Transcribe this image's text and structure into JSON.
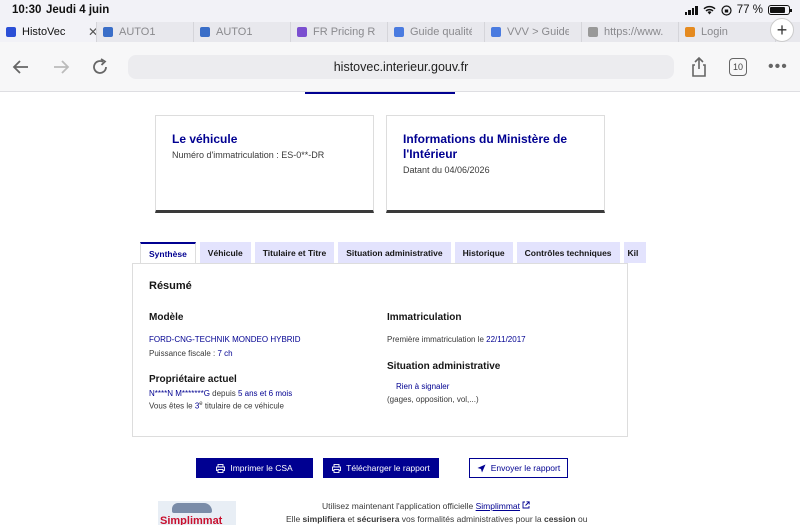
{
  "status": {
    "time": "10:30",
    "date": "Jeudi 4 juin",
    "battery": "77 %"
  },
  "browser_tabs": [
    {
      "label": "HistoVec",
      "active": true,
      "favicon_color": "#2b4fd6"
    },
    {
      "label": "AUTO1",
      "active": false,
      "favicon_color": "#3a6ec8"
    },
    {
      "label": "AUTO1",
      "active": false,
      "favicon_color": "#3a6ec8"
    },
    {
      "label": "FR Pricing Re",
      "active": false,
      "favicon_color": "#7b4fd0"
    },
    {
      "label": "Guide qualité",
      "active": false,
      "favicon_color": "#4a7be0"
    },
    {
      "label": "VVV > Guide",
      "active": false,
      "favicon_color": "#4a7be0"
    },
    {
      "label": "https://www.",
      "active": false,
      "favicon_color": "#999999"
    },
    {
      "label": "Login",
      "active": false,
      "favicon_color": "#e58a1f"
    }
  ],
  "url": "histovec.interieur.gouv.fr",
  "tab_count": "10",
  "cards": {
    "vehicle": {
      "title": "Le véhicule",
      "plate": "Numéro d'immatriculation : ES-0**-DR"
    },
    "ministry": {
      "title": "Informations du Ministère de l'Intérieur",
      "date": "Datant du 04/06/2026"
    }
  },
  "page_tabs": [
    "Synthèse",
    "Véhicule",
    "Titulaire et Titre",
    "Situation administrative",
    "Historique",
    "Contrôles techniques",
    "Kil"
  ],
  "resume": {
    "heading": "Résumé",
    "modele": {
      "label": "Modèle",
      "value": "FORD-CNG-TECHNIK MONDEO HYBRID",
      "puissance_label": "Puissance fiscale : ",
      "puissance_value": "7 ch"
    },
    "proprietaire": {
      "label": "Propriétaire actuel",
      "name": "N****N M*******G",
      "depuis": " depuis ",
      "duree": "5 ans et 6 mois",
      "titulaire_prefix": "Vous êtes le ",
      "titulaire_rank": "3",
      "titulaire_sup": "e",
      "titulaire_suffix": " titulaire de ce véhicule"
    },
    "immatriculation": {
      "label": "Immatriculation",
      "first_label": "Première immatriculation le ",
      "first_date": "22/11/2017"
    },
    "situation": {
      "label": "Situation administrative",
      "value": "Rien à signaler",
      "detail": "(gages, opposition, vol,...)"
    }
  },
  "actions": {
    "print": "Imprimer le CSA",
    "download": "Télécharger le rapport",
    "send": "Envoyer le rapport"
  },
  "simplimmat": {
    "line1_prefix": "Utilisez maintenant l'application officielle ",
    "line1_link": "Simplimmat",
    "line2_prefix": "Elle ",
    "line2_b1": "simplifiera",
    "line2_mid": " et ",
    "line2_b2": "sécurisera",
    "line2_rest": " vos formalités administratives pour la ",
    "line2_b3": "cession",
    "line2_end": " ou",
    "logo_text": "Simplimmat"
  }
}
